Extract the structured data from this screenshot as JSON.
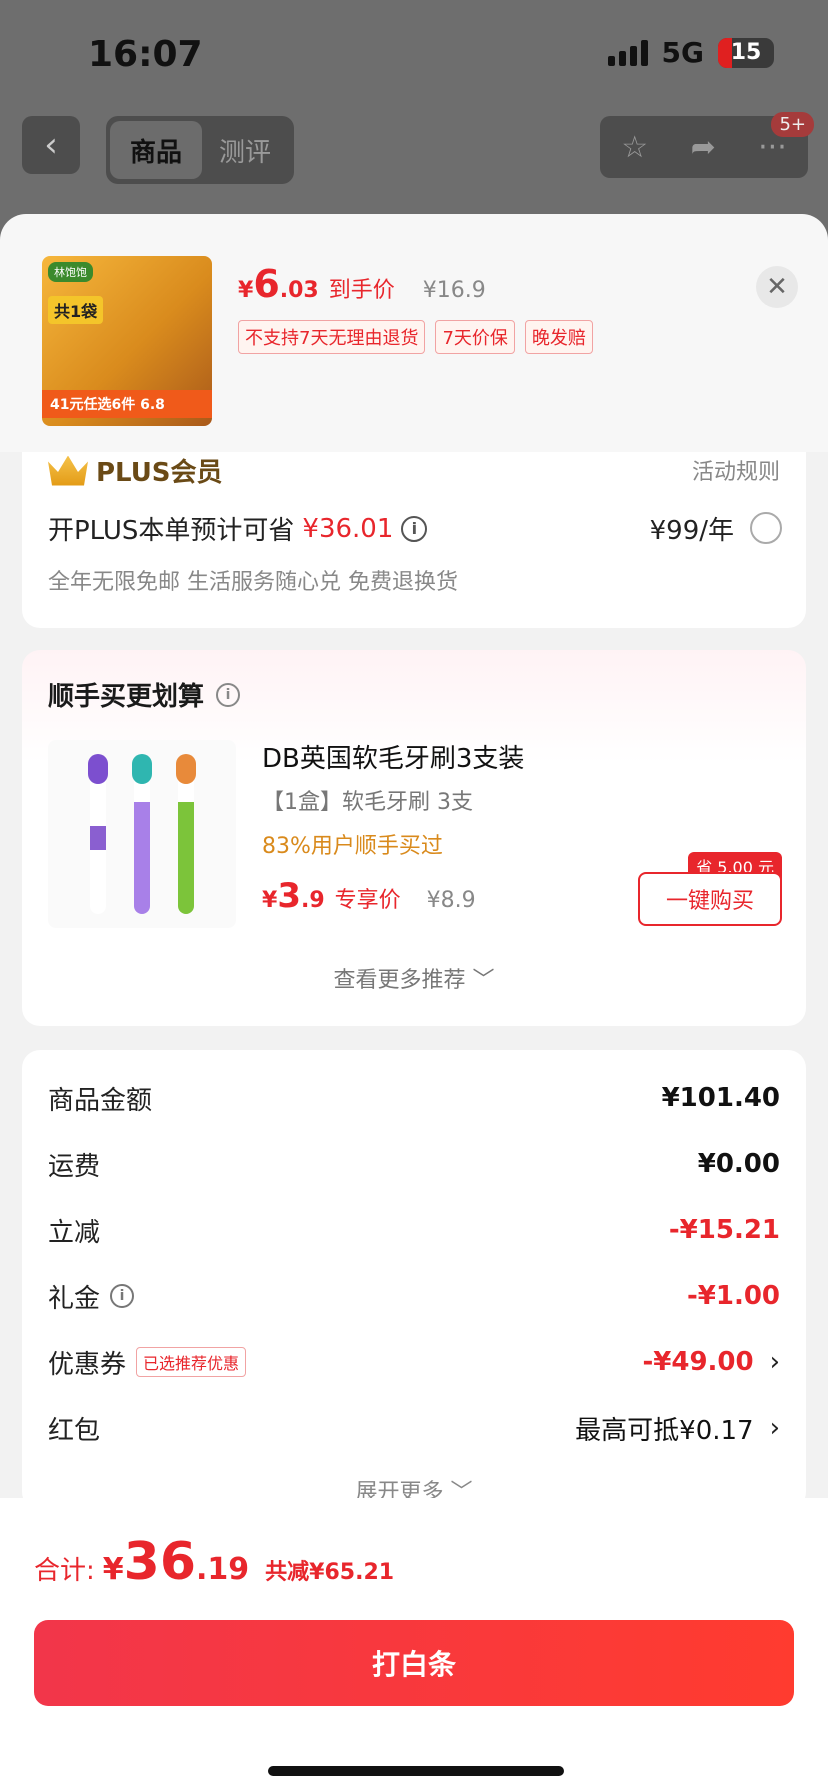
{
  "status_bar": {
    "time": "16:07",
    "network": "5G",
    "battery": "15"
  },
  "nav": {
    "back_icon": "chevron-left-icon",
    "tabs": [
      {
        "label": "商品"
      },
      {
        "label": "测评"
      }
    ],
    "badge": "5+"
  },
  "product": {
    "image": {
      "brand": "林饱饱",
      "count": "共1袋",
      "offer": "41元任选6件 6.8"
    },
    "price_yen": "¥",
    "price_int": "6",
    "price_dec": ".03",
    "price_label": "到手价",
    "original_price": "¥16.9",
    "tags": [
      "不支持7天无理由退货",
      "7天价保",
      "晚发赔"
    ]
  },
  "plus": {
    "name": "PLUS会员",
    "rules": "活动规则",
    "estimate_prefix": "开PLUS本单预计可省",
    "estimate_amount": "¥36.01",
    "fee": "¥99/年",
    "benefits": "全年无限免邮  生活服务随心兑  免费退换货"
  },
  "addon": {
    "title": "顺手买更划算",
    "product_name": "DB英国软毛牙刷3支装",
    "spec": "【1盒】软毛牙刷 3支",
    "social": "83%用户顺手买过",
    "price_yen": "¥",
    "price_int": "3",
    "price_dec": ".9",
    "price_label": "专享价",
    "original_price": "¥8.9",
    "save_badge": "省 5.00 元",
    "buy_label": "一键购买",
    "more_label": "查看更多推荐 ﹀"
  },
  "summary": {
    "rows": [
      {
        "label": "商品金额",
        "value": "¥101.40"
      },
      {
        "label": "运费",
        "value": "¥0.00"
      },
      {
        "label": "立减",
        "value": "-¥15.21"
      },
      {
        "label": "礼金",
        "value": "-¥1.00"
      },
      {
        "label": "优惠券",
        "pill": "已选推荐优惠",
        "value": "-¥49.00"
      },
      {
        "label": "红包",
        "value": "最高可抵¥0.17"
      }
    ],
    "expand_label": "展开更多 ﹀"
  },
  "footer": {
    "total_label": "合计:",
    "total_yen": "¥",
    "total_int": "36",
    "total_dec": ".19",
    "total_discount": "共减¥65.21",
    "pay_label": "打白条"
  },
  "colors": {
    "accent": "#e8262c",
    "plus_gold": "#6a4a16"
  }
}
